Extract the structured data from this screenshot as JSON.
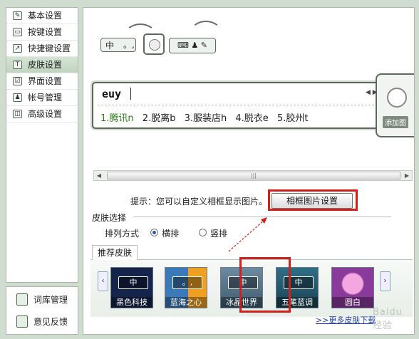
{
  "sidebar": {
    "items": [
      {
        "label": "基本设置",
        "icon": "wrench-icon",
        "active": false
      },
      {
        "label": "按键设置",
        "icon": "keyboard-icon",
        "active": false
      },
      {
        "label": "快捷键设置",
        "icon": "shortcut-icon",
        "active": false
      },
      {
        "label": "皮肤设置",
        "icon": "shirt-icon",
        "active": true
      },
      {
        "label": "界面设置",
        "icon": "window-icon",
        "active": false
      },
      {
        "label": "帐号管理",
        "icon": "user-icon",
        "active": false
      },
      {
        "label": "高级设置",
        "icon": "advanced-icon",
        "active": false
      }
    ]
  },
  "bottom_nav": {
    "items": [
      {
        "label": "词库管理",
        "icon": "dictionary-icon"
      },
      {
        "label": "意见反馈",
        "icon": "feedback-icon"
      }
    ]
  },
  "preview": {
    "status_bar": {
      "mode": "中",
      "punct": "。,",
      "tools": "⌨ ♟ ✎"
    },
    "composer": {
      "input": "euy",
      "candidates": [
        "1.腾讯n",
        "2.脱离b",
        "3.服装店h",
        "4.脱衣e",
        "5.胶州t"
      ],
      "pager": "◀ ▶",
      "add_image_label": "添加图"
    },
    "scroll_grip": "|||"
  },
  "frame_tip": {
    "text": "提示：您可以自定义相框显示图片。",
    "button_label": "相框图片设置"
  },
  "skin_select": {
    "section_title": "皮肤选择",
    "arrange_label": "排列方式",
    "options": [
      {
        "label": "横排",
        "selected": true
      },
      {
        "label": "竖排",
        "selected": false
      }
    ],
    "tab_label": "推荐皮肤",
    "prev_arrow": "‹",
    "next_arrow": "›",
    "skins": [
      {
        "name": "黑色科技",
        "badge": "中",
        "color": "#14244a",
        "selected": false
      },
      {
        "name": "蓝海之心",
        "badge": "。,",
        "color": "#3b7ab8",
        "selected": true
      },
      {
        "name": "冰晶世界",
        "badge": "中",
        "color": "#6c8aa0",
        "selected": false
      },
      {
        "name": "五笔蓝调",
        "badge": "中",
        "color": "#2f6e86",
        "selected": false
      },
      {
        "name": "圆白",
        "badge": "",
        "color": "#8a3a9a",
        "selected": false
      }
    ],
    "more_link": ">>更多皮肤下载"
  },
  "watermark": "Baidu 经验",
  "colors": {
    "highlight_red": "#d0201e",
    "link_blue": "#1c3fb8",
    "first_candidate": "#2e7d1f"
  }
}
